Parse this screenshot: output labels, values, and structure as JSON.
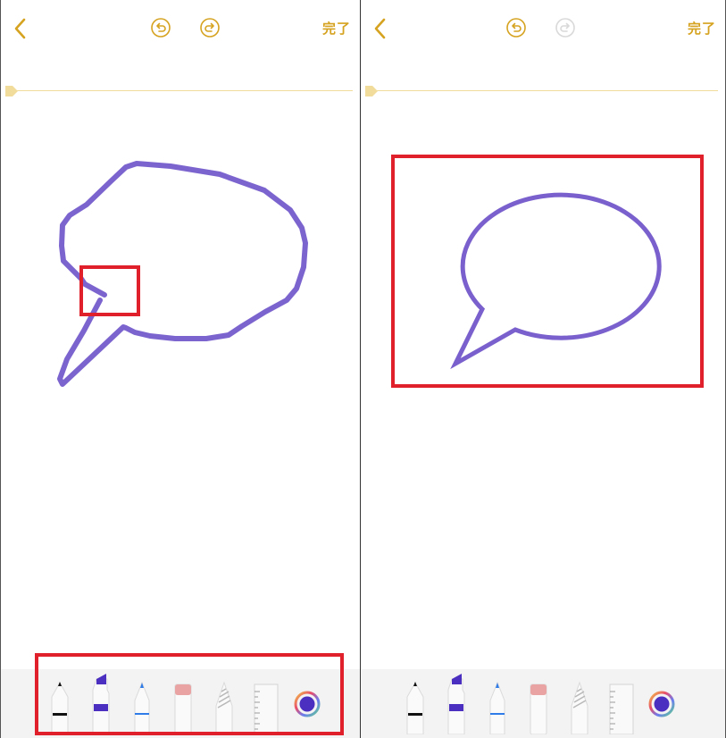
{
  "screens": [
    {
      "id": "left",
      "header": {
        "done_label": "完了",
        "redo_enabled": true
      },
      "toolbar": {
        "tools": [
          "pen",
          "marker",
          "pencil",
          "eraser",
          "lasso",
          "ruler"
        ],
        "selected_color": "#4a2fc0"
      },
      "drawing": {
        "shape": "speech-bubble",
        "style": "hand-drawn",
        "stroke_color": "#6a4fc8"
      }
    },
    {
      "id": "right",
      "header": {
        "done_label": "完了",
        "redo_enabled": false
      },
      "toolbar": {
        "tools": [
          "pen",
          "marker",
          "pencil",
          "eraser",
          "lasso",
          "ruler"
        ],
        "selected_color": "#4a2fc0"
      },
      "drawing": {
        "shape": "speech-bubble",
        "style": "smoothed",
        "stroke_color": "#6a4fc8"
      }
    }
  ],
  "theme": {
    "accent": "#d6a320",
    "highlight_box": "#e0202a",
    "toolbar_bg": "#f3f3f3",
    "ruler_line": "#f2dc9c"
  },
  "icons": {
    "back": "chevron-left-icon",
    "undo": "undo-icon",
    "redo": "redo-icon",
    "color_picker": "color-wheel-icon"
  }
}
